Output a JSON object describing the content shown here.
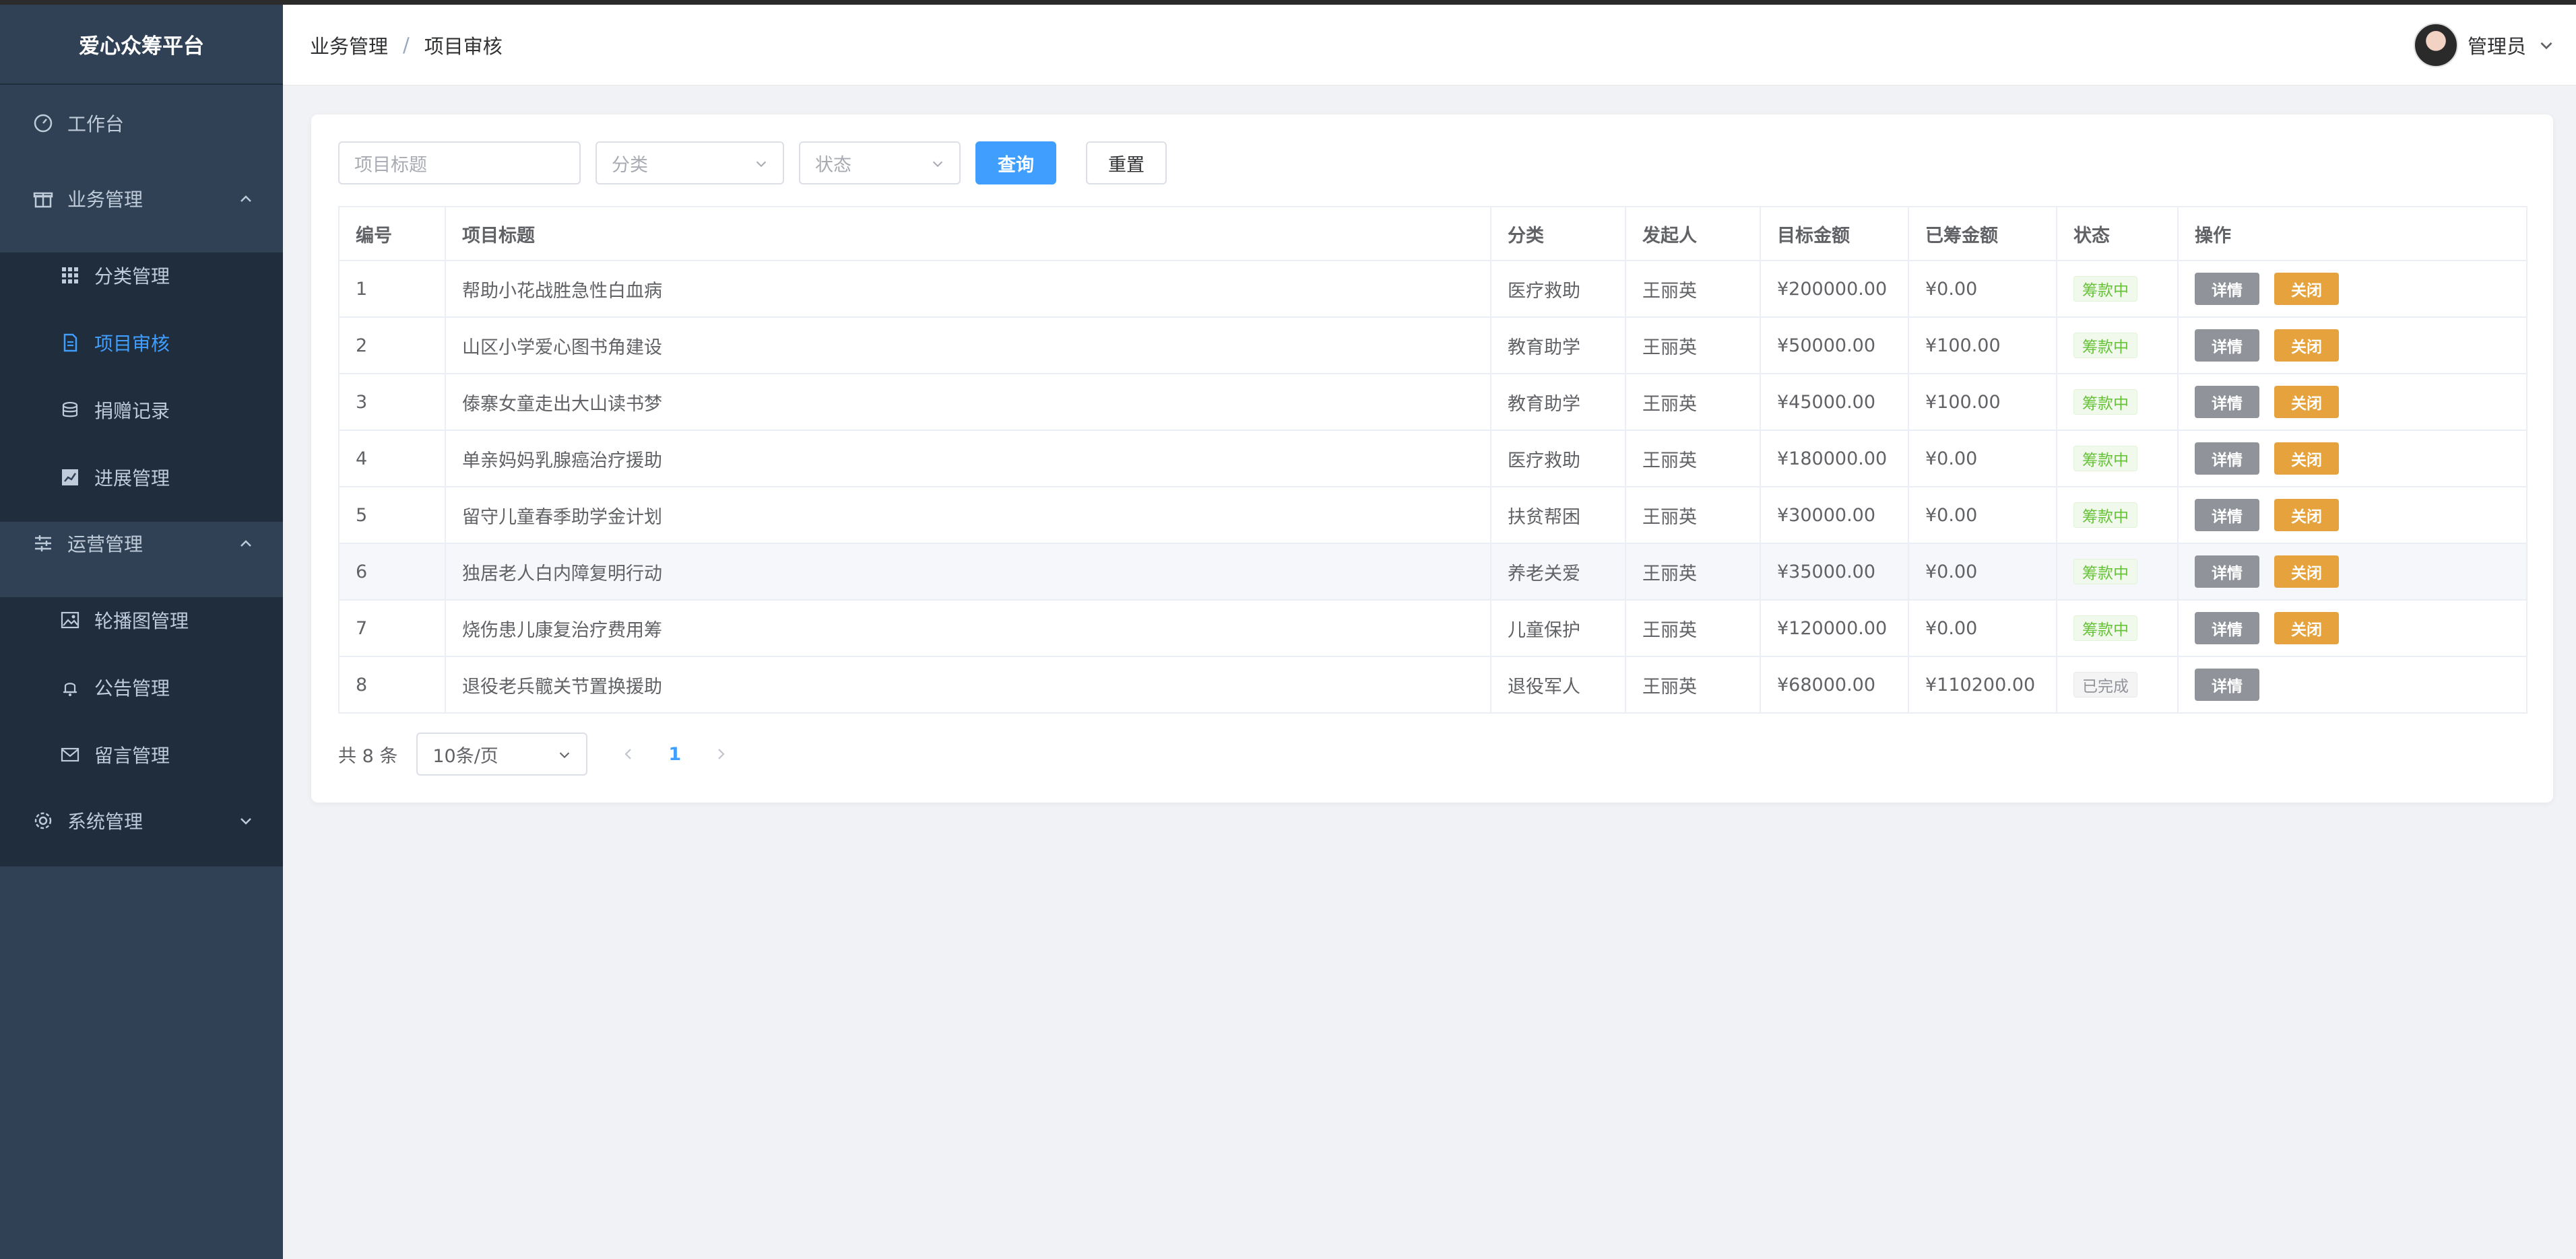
{
  "app": {
    "title": "爱心众筹平台"
  },
  "sidebar": {
    "items": [
      {
        "label": "工作台",
        "icon": "dashboard-icon"
      },
      {
        "label": "业务管理",
        "icon": "gift-icon",
        "expanded": true,
        "children": [
          {
            "label": "分类管理",
            "icon": "grid-icon"
          },
          {
            "label": "项目审核",
            "icon": "document-icon",
            "active": true
          },
          {
            "label": "捐赠记录",
            "icon": "coins-icon"
          },
          {
            "label": "进展管理",
            "icon": "chart-icon"
          }
        ]
      },
      {
        "label": "运营管理",
        "icon": "sliders-icon",
        "expanded": true,
        "children": [
          {
            "label": "轮播图管理",
            "icon": "image-icon"
          },
          {
            "label": "公告管理",
            "icon": "bell-icon"
          },
          {
            "label": "留言管理",
            "icon": "mail-icon"
          }
        ]
      },
      {
        "label": "系统管理",
        "icon": "settings-icon",
        "expanded": false
      }
    ]
  },
  "header": {
    "breadcrumb": [
      "业务管理",
      "项目审核"
    ],
    "breadcrumb_sep": "/",
    "user_name": "管理员"
  },
  "filters": {
    "title_placeholder": "项目标题",
    "category_placeholder": "分类",
    "status_placeholder": "状态",
    "search_label": "查询",
    "reset_label": "重置"
  },
  "table": {
    "columns": [
      "编号",
      "项目标题",
      "分类",
      "发起人",
      "目标金额",
      "已筹金额",
      "状态",
      "操作"
    ],
    "rows": [
      {
        "id": "1",
        "title": "帮助小花战胜急性白血病",
        "category": "医疗救助",
        "initiator": "王丽英",
        "target": "¥200000.00",
        "raised": "¥0.00",
        "status": "筹款中",
        "actions": [
          "详情",
          "关闭"
        ]
      },
      {
        "id": "2",
        "title": "山区小学爱心图书角建设",
        "category": "教育助学",
        "initiator": "王丽英",
        "target": "¥50000.00",
        "raised": "¥100.00",
        "status": "筹款中",
        "actions": [
          "详情",
          "关闭"
        ]
      },
      {
        "id": "3",
        "title": "傣寨女童走出大山读书梦",
        "category": "教育助学",
        "initiator": "王丽英",
        "target": "¥45000.00",
        "raised": "¥100.00",
        "status": "筹款中",
        "actions": [
          "详情",
          "关闭"
        ]
      },
      {
        "id": "4",
        "title": "单亲妈妈乳腺癌治疗援助",
        "category": "医疗救助",
        "initiator": "王丽英",
        "target": "¥180000.00",
        "raised": "¥0.00",
        "status": "筹款中",
        "actions": [
          "详情",
          "关闭"
        ]
      },
      {
        "id": "5",
        "title": "留守儿童春季助学金计划",
        "category": "扶贫帮困",
        "initiator": "王丽英",
        "target": "¥30000.00",
        "raised": "¥0.00",
        "status": "筹款中",
        "actions": [
          "详情",
          "关闭"
        ]
      },
      {
        "id": "6",
        "title": "独居老人白内障复明行动",
        "category": "养老关爱",
        "initiator": "王丽英",
        "target": "¥35000.00",
        "raised": "¥0.00",
        "status": "筹款中",
        "actions": [
          "详情",
          "关闭"
        ],
        "highlight": true
      },
      {
        "id": "7",
        "title": "烧伤患儿康复治疗费用筹",
        "category": "儿童保护",
        "initiator": "王丽英",
        "target": "¥120000.00",
        "raised": "¥0.00",
        "status": "筹款中",
        "actions": [
          "详情",
          "关闭"
        ]
      },
      {
        "id": "8",
        "title": "退役老兵髋关节置换援助",
        "category": "退役军人",
        "initiator": "王丽英",
        "target": "¥68000.00",
        "raised": "¥110200.00",
        "status": "已完成",
        "actions": [
          "详情"
        ]
      }
    ]
  },
  "pagination": {
    "total_label": "共 8 条",
    "page_size": "10条/页",
    "current_page": "1"
  },
  "colors": {
    "sidebar_bg": "#304156",
    "accent": "#409eff",
    "tag_raising": "#67c23a",
    "tag_done": "#909399",
    "detail_btn": "#909399",
    "close_btn": "#e6a23c"
  }
}
